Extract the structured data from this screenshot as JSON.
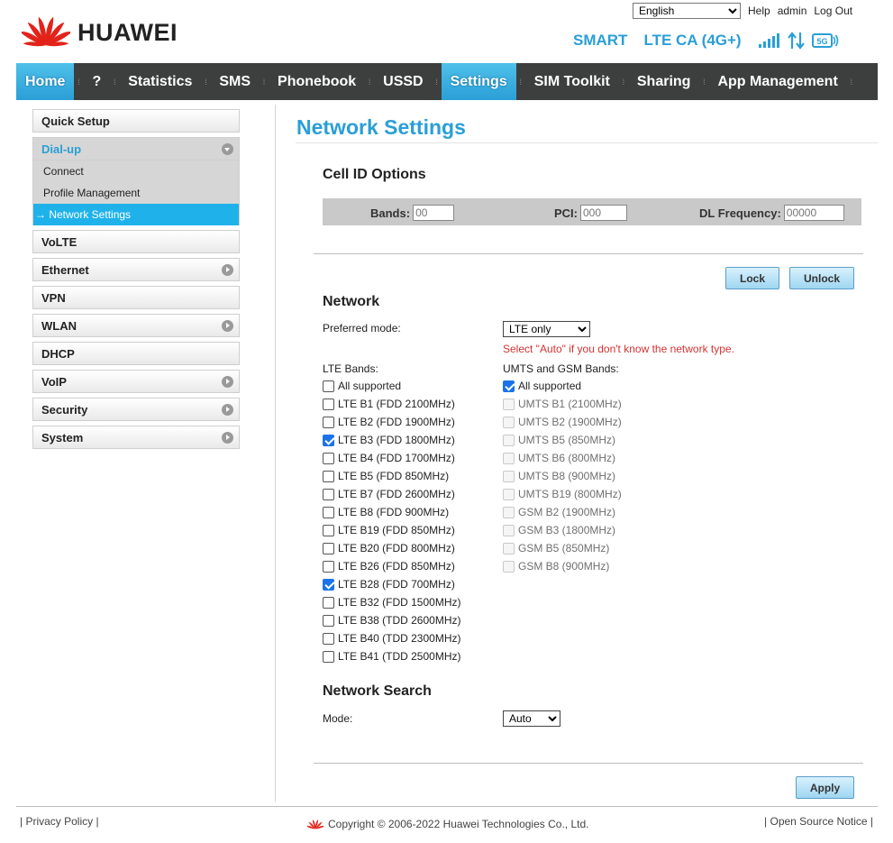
{
  "header": {
    "brand": "HUAWEI",
    "language": "English",
    "links": {
      "help": "Help",
      "user": "admin",
      "logout": "Log Out"
    },
    "carrier": "SMART",
    "network": "LTE CA (4G+)"
  },
  "nav": [
    "Home",
    "?",
    "Statistics",
    "SMS",
    "Phonebook",
    "USSD",
    "Settings",
    "SIM Toolkit",
    "Sharing",
    "App Management"
  ],
  "sidebar": {
    "quick_setup": "Quick Setup",
    "dialup": "Dial-up",
    "dialup_sub": [
      "Connect",
      "Profile Management",
      "→ Network Settings"
    ],
    "items": [
      "VoLTE",
      "Ethernet",
      "VPN",
      "WLAN",
      "DHCP",
      "VoIP",
      "Security",
      "System"
    ]
  },
  "main": {
    "title": "Network Settings",
    "cell": {
      "heading": "Cell ID Options",
      "bands_label": "Bands:",
      "bands_placeholder": "00",
      "pci_label": "PCI:",
      "pci_placeholder": "000",
      "dl_label": "DL Frequency:",
      "dl_placeholder": "00000",
      "lock": "Lock",
      "unlock": "Unlock"
    },
    "network": {
      "heading": "Network",
      "preferred_label": "Preferred mode:",
      "preferred_value": "LTE only",
      "hint": "Select \"Auto\" if you don't know the network type.",
      "lte_label": "LTE Bands:",
      "umts_label": "UMTS and GSM Bands:",
      "lte_bands": [
        {
          "label": "All supported",
          "checked": false
        },
        {
          "label": "LTE B1 (FDD 2100MHz)",
          "checked": false
        },
        {
          "label": "LTE B2 (FDD 1900MHz)",
          "checked": false
        },
        {
          "label": "LTE B3 (FDD 1800MHz)",
          "checked": true
        },
        {
          "label": "LTE B4 (FDD 1700MHz)",
          "checked": false
        },
        {
          "label": "LTE B5 (FDD 850MHz)",
          "checked": false
        },
        {
          "label": "LTE B7 (FDD 2600MHz)",
          "checked": false
        },
        {
          "label": "LTE B8 (FDD 900MHz)",
          "checked": false
        },
        {
          "label": "LTE B19 (FDD 850MHz)",
          "checked": false
        },
        {
          "label": "LTE B20 (FDD 800MHz)",
          "checked": false
        },
        {
          "label": "LTE B26 (FDD 850MHz)",
          "checked": false
        },
        {
          "label": "LTE B28 (FDD 700MHz)",
          "checked": true
        },
        {
          "label": "LTE B32 (FDD 1500MHz)",
          "checked": false
        },
        {
          "label": "LTE B38 (TDD 2600MHz)",
          "checked": false
        },
        {
          "label": "LTE B40 (TDD 2300MHz)",
          "checked": false
        },
        {
          "label": "LTE B41 (TDD 2500MHz)",
          "checked": false
        }
      ],
      "umts_bands": [
        {
          "label": "All supported",
          "checked": true,
          "disabled": false
        },
        {
          "label": "UMTS B1 (2100MHz)",
          "checked": false,
          "disabled": true
        },
        {
          "label": "UMTS B2 (1900MHz)",
          "checked": false,
          "disabled": true
        },
        {
          "label": "UMTS B5 (850MHz)",
          "checked": false,
          "disabled": true
        },
        {
          "label": "UMTS B6 (800MHz)",
          "checked": false,
          "disabled": true
        },
        {
          "label": "UMTS B8 (900MHz)",
          "checked": false,
          "disabled": true
        },
        {
          "label": "UMTS B19 (800MHz)",
          "checked": false,
          "disabled": true
        },
        {
          "label": "GSM B2 (1900MHz)",
          "checked": false,
          "disabled": true
        },
        {
          "label": "GSM B3 (1800MHz)",
          "checked": false,
          "disabled": true
        },
        {
          "label": "GSM B5 (850MHz)",
          "checked": false,
          "disabled": true
        },
        {
          "label": "GSM B8 (900MHz)",
          "checked": false,
          "disabled": true
        }
      ]
    },
    "search": {
      "heading": "Network Search",
      "mode_label": "Mode:",
      "mode_value": "Auto"
    },
    "apply": "Apply"
  },
  "footer": {
    "privacy": "Privacy Policy",
    "copyright": "Copyright © 2006-2022 Huawei Technologies Co., Ltd.",
    "open_source": "Open Source Notice"
  },
  "colors": {
    "accent": "#2a9fd6",
    "nav_bg": "#3d3f3f",
    "active_side": "#1fb2ea",
    "hint": "#d23333",
    "brand_red": "#e2231a"
  },
  "icons": [
    "huawei-logo-icon",
    "signal-icon",
    "data-transfer-icon",
    "5g-icon",
    "chevron-right-icon",
    "chevron-down-icon"
  ]
}
